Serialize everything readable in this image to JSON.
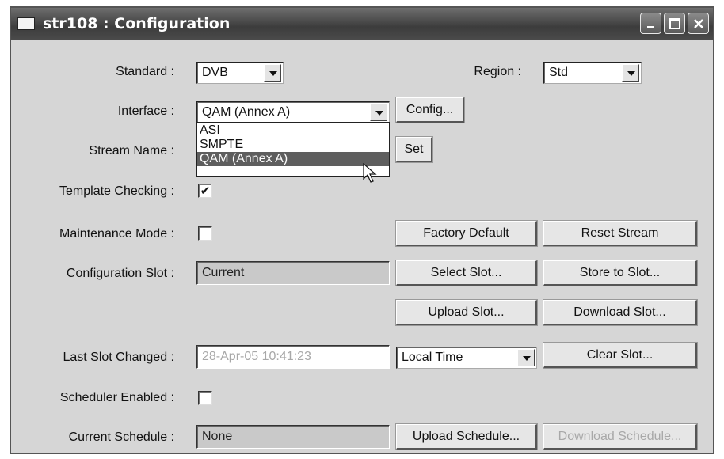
{
  "window": {
    "title": "str108 : Configuration"
  },
  "controls": {
    "minimize_icon": "minimize-icon",
    "maximize_icon": "maximize-icon",
    "close_icon": "close-icon"
  },
  "labels": {
    "standard": "Standard :",
    "region": "Region :",
    "interface": "Interface :",
    "stream_name": "Stream Name :",
    "template_checking": "Template Checking :",
    "maintenance_mode": "Maintenance Mode :",
    "configuration_slot": "Configuration Slot :",
    "last_slot_changed": "Last Slot Changed :",
    "scheduler_enabled": "Scheduler Enabled :",
    "current_schedule": "Current Schedule :"
  },
  "standard": {
    "value": "DVB"
  },
  "region": {
    "value": "Std"
  },
  "interface": {
    "value": "QAM (Annex A)",
    "options": [
      "ASI",
      "SMPTE",
      "QAM (Annex A)"
    ],
    "highlighted": "QAM (Annex A)"
  },
  "template_checking": {
    "checked": true,
    "mark": "✔"
  },
  "maintenance_mode": {
    "checked": false
  },
  "scheduler_enabled": {
    "checked": false
  },
  "configuration_slot": {
    "value": "Current"
  },
  "last_slot_changed": {
    "value": "28-Apr-05 10:41:23"
  },
  "time_mode": {
    "value": "Local Time"
  },
  "current_schedule": {
    "value": "None"
  },
  "buttons": {
    "config": "Config...",
    "set": "Set",
    "factory_default": "Factory Default",
    "reset_stream": "Reset Stream",
    "select_slot": "Select Slot...",
    "store_to_slot": "Store to Slot...",
    "upload_slot": "Upload Slot...",
    "download_slot": "Download Slot...",
    "clear_slot": "Clear Slot...",
    "upload_schedule": "Upload Schedule...",
    "download_schedule": "Download Schedule..."
  }
}
